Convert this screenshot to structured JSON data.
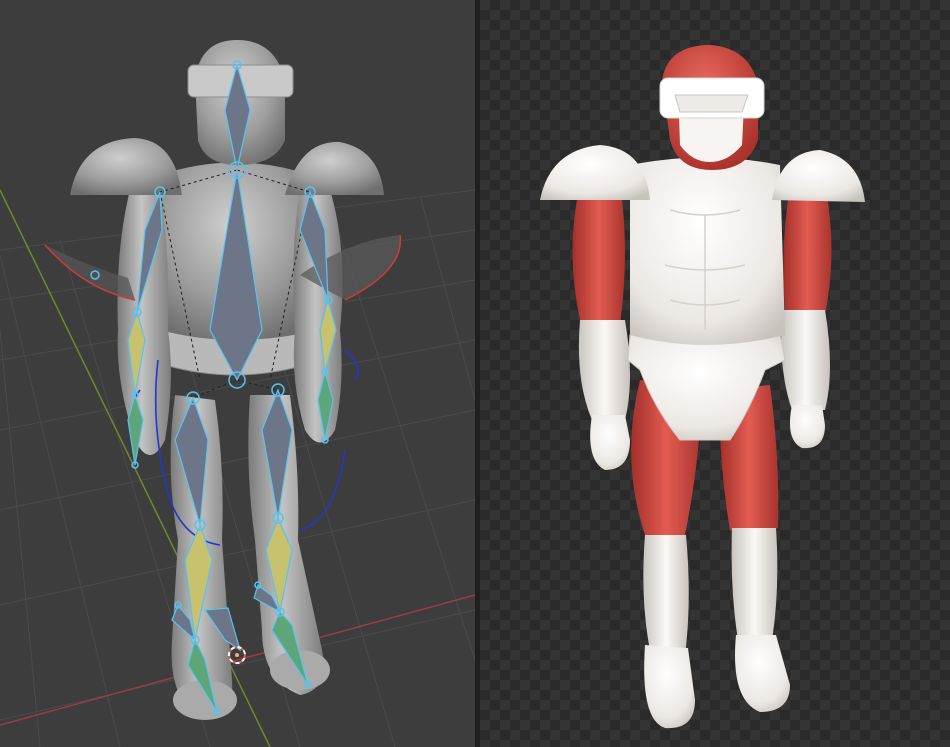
{
  "viewports": [
    {
      "name": "armature-edit-viewport",
      "shading": "solid",
      "overlay": "armature-bones"
    },
    {
      "name": "rendered-preview-viewport",
      "shading": "rendered",
      "background": "transparent-checker"
    }
  ],
  "colors": {
    "viewport_bg": "#3d3d3d",
    "grid_line": "#4a4a4a",
    "x_axis": "#9b3b48",
    "y_axis": "#6c8a2a",
    "bone_fill": "#6d7688",
    "bone_outline": "#58c3f0",
    "bone_ik": "#c8c16d",
    "bone_ik_green": "#5fa57a",
    "ik_curve": "#2337c8",
    "model_grey": "#a9a9a9",
    "model_red": "#d44a43",
    "model_white": "#f1eeeb",
    "checker_dark": "#2a2a2a",
    "checker_light": "#343434"
  },
  "icons": {
    "origin": "cursor-3d-icon",
    "bone_joint": "bone-joint-icon"
  }
}
